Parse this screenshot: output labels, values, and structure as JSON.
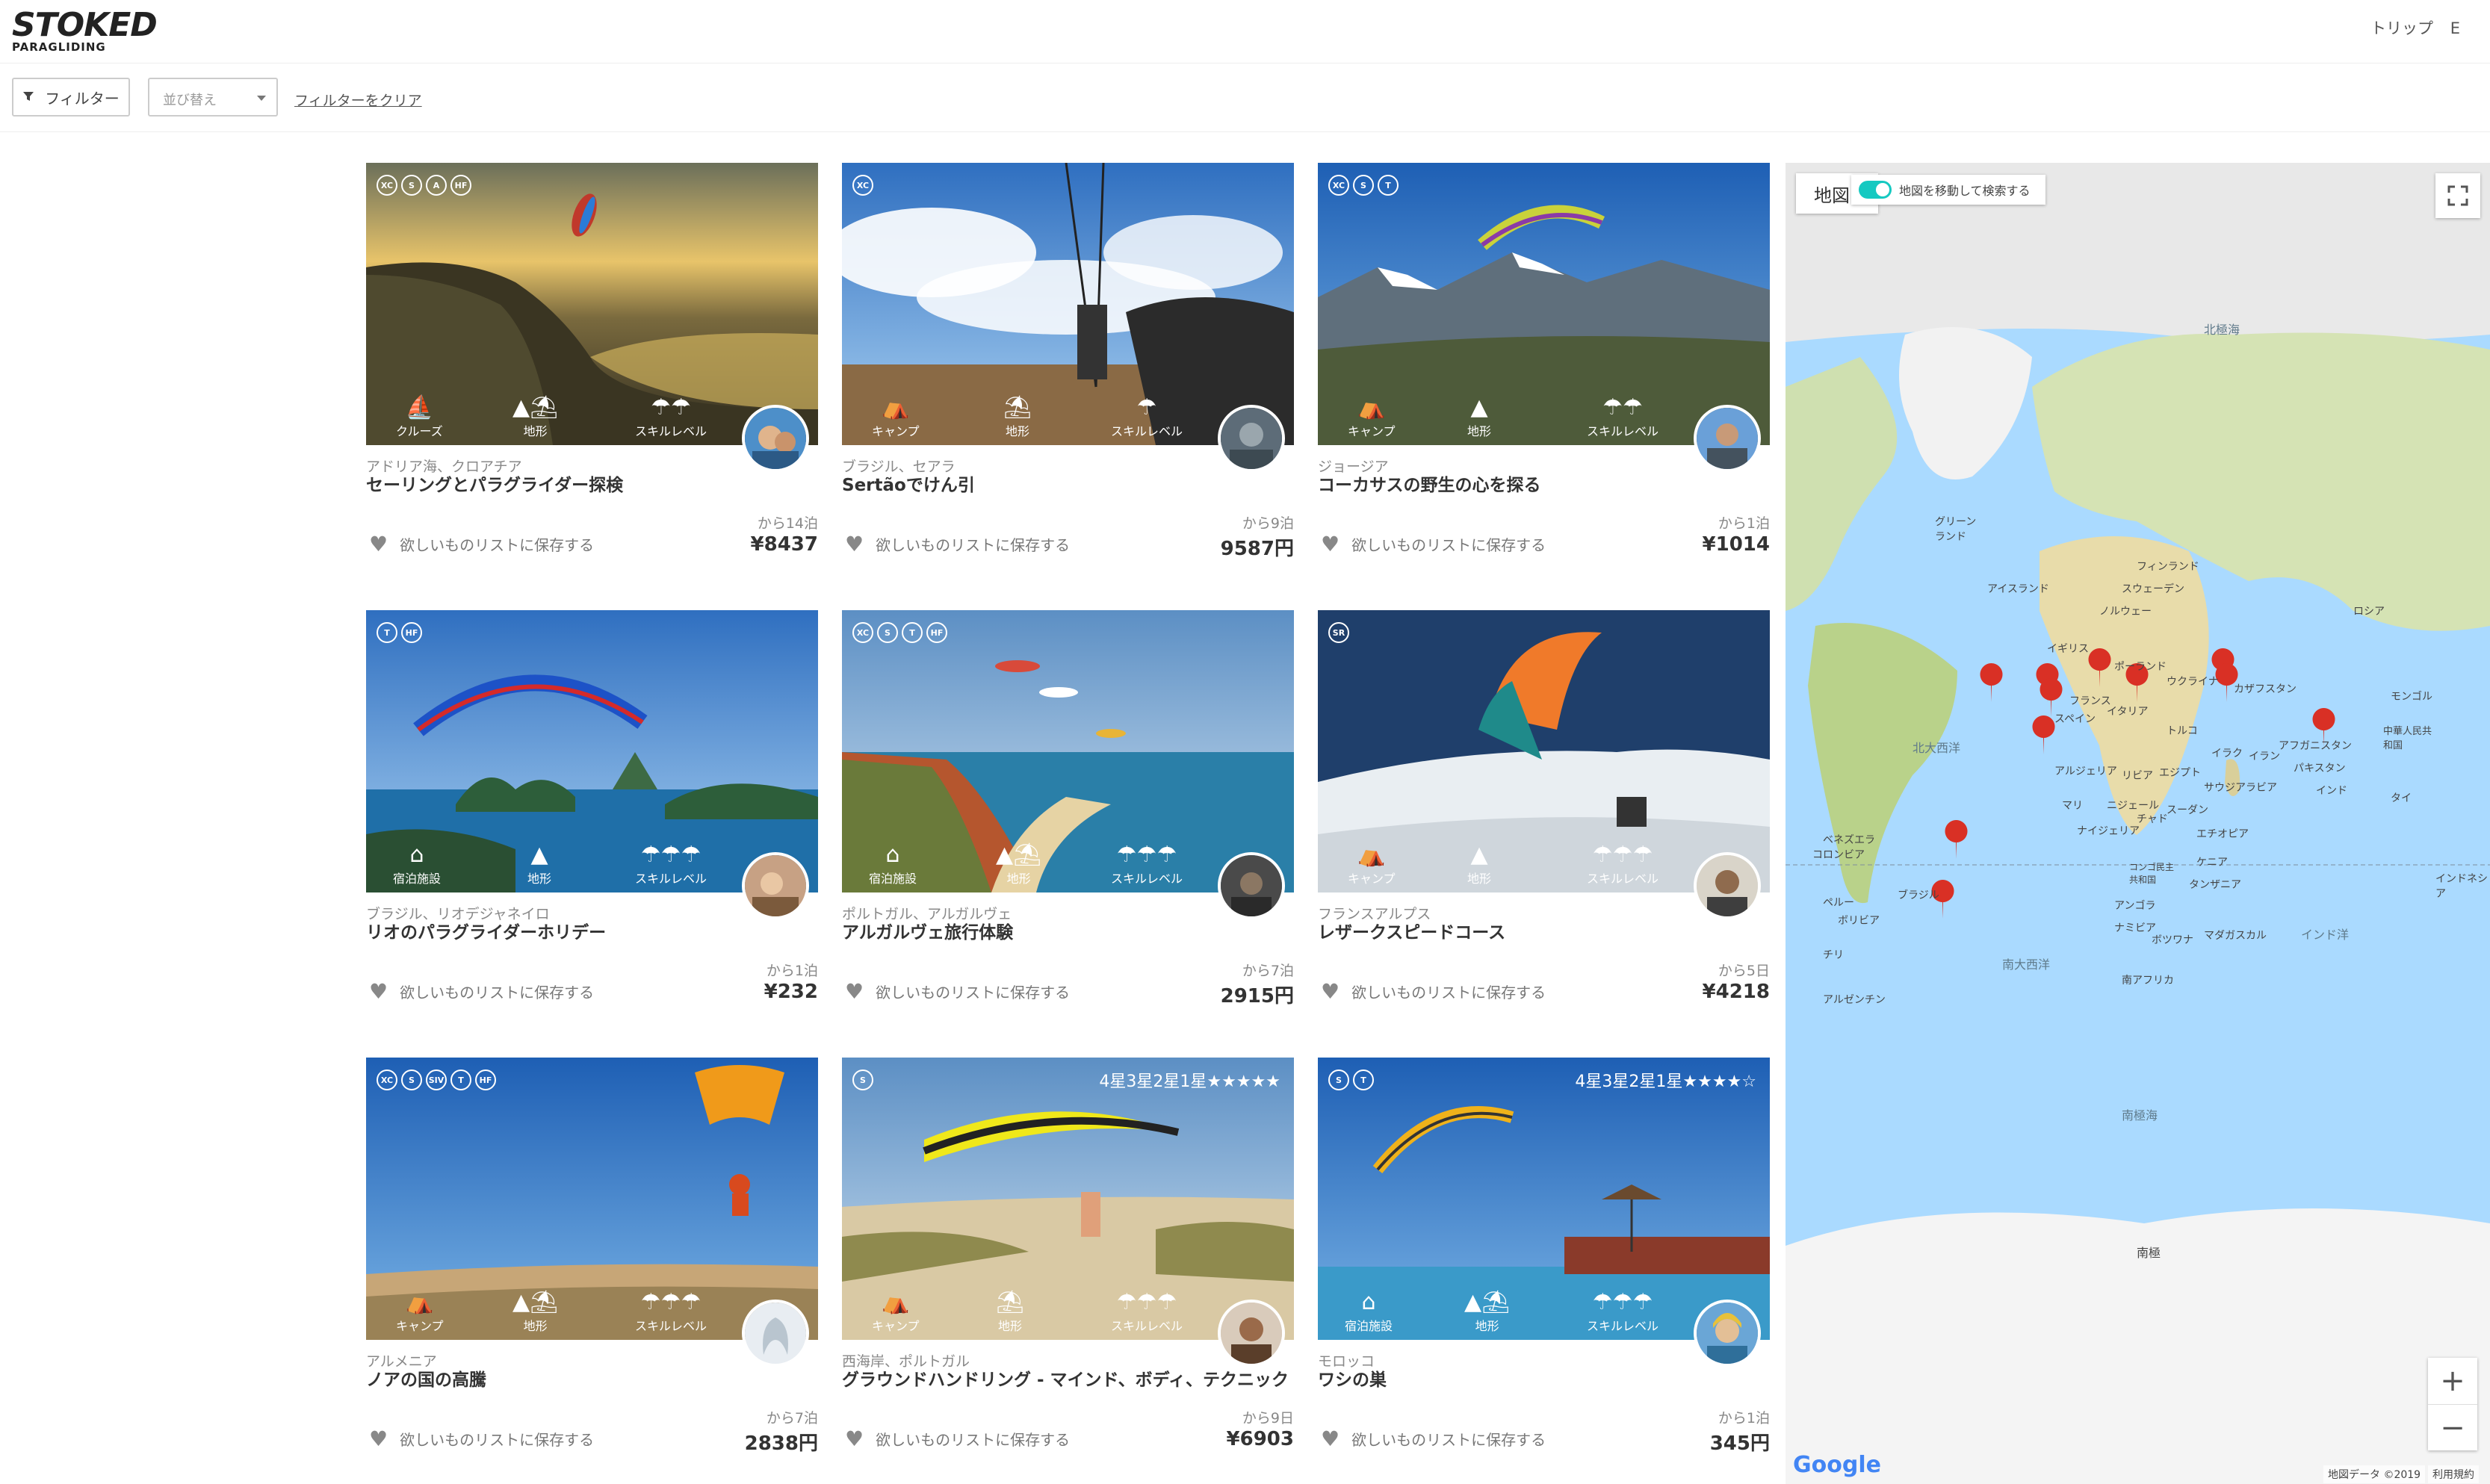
{
  "header": {
    "logo_main": "STOKED",
    "logo_sub": "PARAGLIDING",
    "nav": [
      "トリップ",
      "E"
    ]
  },
  "toolbar": {
    "filter_label": "フィルター",
    "sort_placeholder": "並び替え",
    "clear_label": "フィルターをクリア"
  },
  "cards": [
    {
      "badges": [
        "XC",
        "S",
        "A",
        "HF"
      ],
      "rating": "",
      "features": [
        "クルーズ",
        "地形",
        "スキルレベル"
      ],
      "location": "アドリア海、クロアチア",
      "title": "セーリングとパラグライダー探検",
      "nights": "から14泊",
      "price": "¥8437",
      "wishlist": "欲しいものリストに保存する"
    },
    {
      "badges": [
        "XC"
      ],
      "rating": "",
      "features": [
        "キャンプ",
        "地形",
        "スキルレベル"
      ],
      "location": "ブラジル、セアラ",
      "title": "Sertãoでけん引",
      "nights": "から9泊",
      "price": "9587円",
      "wishlist": "欲しいものリストに保存する"
    },
    {
      "badges": [
        "XC",
        "S",
        "T"
      ],
      "rating": "",
      "features": [
        "キャンプ",
        "地形",
        "スキルレベル"
      ],
      "location": "ジョージア",
      "title": "コーカサスの野生の心を探る",
      "nights": "から1泊",
      "price": "¥1014",
      "wishlist": "欲しいものリストに保存する"
    },
    {
      "badges": [
        "T",
        "HF"
      ],
      "rating": "",
      "features": [
        "宿泊施設",
        "地形",
        "スキルレベル"
      ],
      "location": "ブラジル、リオデジャネイロ",
      "title": "リオのパラグライダーホリデー",
      "nights": "から1泊",
      "price": "¥232",
      "wishlist": "欲しいものリストに保存する"
    },
    {
      "badges": [
        "XC",
        "S",
        "T",
        "HF"
      ],
      "rating": "",
      "features": [
        "宿泊施設",
        "地形",
        "スキルレベル"
      ],
      "location": "ポルトガル、アルガルヴェ",
      "title": "アルガルヴェ旅行体験",
      "nights": "から7泊",
      "price": "2915円",
      "wishlist": "欲しいものリストに保存する"
    },
    {
      "badges": [
        "SR"
      ],
      "rating": "",
      "features": [
        "キャンプ",
        "地形",
        "スキルレベル"
      ],
      "location": "フランスアルプス",
      "title": "レザークスピードコース",
      "nights": "から5日",
      "price": "¥4218",
      "wishlist": "欲しいものリストに保存する"
    },
    {
      "badges": [
        "XC",
        "S",
        "SIV",
        "T",
        "HF"
      ],
      "rating": "",
      "features": [
        "キャンプ",
        "地形",
        "スキルレベル"
      ],
      "location": "アルメニア",
      "title": "ノアの国の高騰",
      "nights": "から7泊",
      "price": "2838円",
      "wishlist": "欲しいものリストに保存する"
    },
    {
      "badges": [
        "S"
      ],
      "rating": "4星3星2星1星★★★★★",
      "features": [
        "キャンプ",
        "地形",
        "スキルレベル"
      ],
      "location": "西海岸、ポルトガル",
      "title": "グラウンドハンドリング - マインド、ボディ、テクニック",
      "nights": "から9日",
      "price": "¥6903",
      "wishlist": "欲しいものリストに保存する"
    },
    {
      "badges": [
        "S",
        "T"
      ],
      "rating": "4星3星2星1星★★★★☆",
      "features": [
        "宿泊施設",
        "地形",
        "スキルレベル"
      ],
      "location": "モロッコ",
      "title": "ワシの巣",
      "nights": "から1泊",
      "price": "345円",
      "wishlist": "欲しいものリストに保存する"
    }
  ],
  "map": {
    "map_tab": "地図",
    "search_toggle": "地図を移動して検索する",
    "labels": {
      "arctic": "北極海",
      "greenland": "グリーンランド",
      "iceland": "アイスランド",
      "finland": "フィンランド",
      "sweden": "スウェーデン",
      "norway": "ノルウェー",
      "russia": "ロシア",
      "uk": "イギリス",
      "poland": "ポーランド",
      "ukraine": "ウクライナ",
      "kazakhstan": "カザフスタン",
      "mongolia": "モンゴル",
      "china": "中華人民共和国",
      "france": "フランス",
      "spain": "スペイン",
      "italy": "イタリア",
      "turkey": "トルコ",
      "iran": "イラン",
      "afghanistan": "アフガニスタン",
      "iraq": "イラク",
      "pakistan": "パキスタン",
      "india": "インド",
      "thailand": "タイ",
      "north_atlantic": "北大西洋",
      "algeria": "アルジェリア",
      "libya": "リビア",
      "egypt": "エジプト",
      "saudi": "サウジアラビア",
      "mali": "マリ",
      "niger": "ニジェール",
      "chad": "チャド",
      "sudan": "スーダン",
      "nigeria": "ナイジェリア",
      "ethiopia": "エチオピア",
      "kenya": "ケニア",
      "drc": "コンゴ民主共和国",
      "tanzania": "タンザニア",
      "angola": "アンゴラ",
      "namibia": "ナミビア",
      "botswana": "ボツワナ",
      "madagascar": "マダガスカル",
      "south_africa": "南アフリカ",
      "venezuela": "ベネズエラ",
      "colombia": "コロンビア",
      "brazil": "ブラジル",
      "peru": "ペルー",
      "bolivia": "ボリビア",
      "chile": "チリ",
      "argentina": "アルゼンチン",
      "south_atlantic": "南大西洋",
      "indian_ocean": "インド洋",
      "indonesia": "インドネシア",
      "southern_ocean": "南極海",
      "antarctica": "南極"
    },
    "google": "Google",
    "attribution": "地図データ ©2019",
    "terms": "利用規約",
    "zoom_in": "+",
    "zoom_out": "−"
  },
  "icons": {
    "filter": "funnel-icon",
    "heart": "heart-icon",
    "fullscreen": "fullscreen-icon",
    "pin": "map-pin-icon"
  }
}
